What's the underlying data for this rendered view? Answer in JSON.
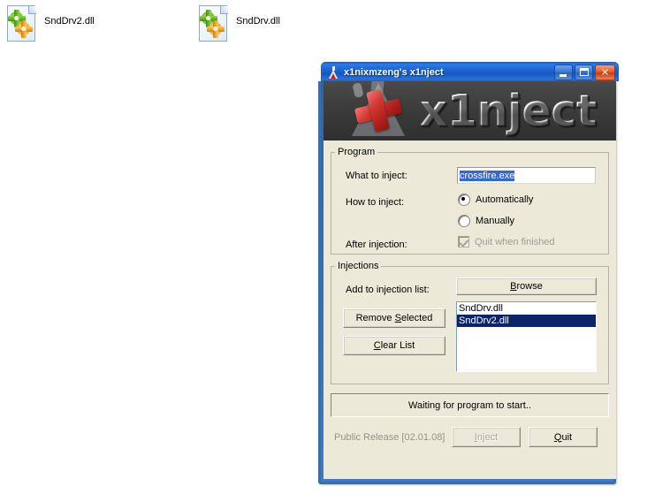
{
  "desktop": {
    "background_color": "#ffffff",
    "icons": [
      {
        "label": "SndDrv2.dll",
        "icon": "dll-file-gears-icon"
      },
      {
        "label": "SndDrv.dll",
        "icon": "dll-file-gears-icon"
      }
    ]
  },
  "window": {
    "title": "x1nixmzeng's x1nject",
    "title_icon": "flask-icon",
    "titlebar_color": "#1d63d0",
    "controls": {
      "minimize": "minimize-icon",
      "maximize": "maximize-icon",
      "close": "close-icon"
    },
    "banner": {
      "logo_text": "x1nject",
      "logo_icon": "red-cross-flask-icon",
      "background_color": "#3c3c3c"
    },
    "program_group": {
      "legend": "Program",
      "what_to_inject_label": "What to inject:",
      "what_to_inject_value": "crossfire.exe",
      "what_to_inject_placeholder": "",
      "how_to_inject_label": "How to inject:",
      "radio_automatically": "Automatically",
      "radio_manually": "Manually",
      "selected_mode": "Automatically",
      "after_injection_label": "After injection:",
      "quit_when_finished": "Quit when finished",
      "quit_when_finished_checked": true,
      "quit_when_finished_enabled": false
    },
    "injections_group": {
      "legend": "Injections",
      "add_label": "Add to injection list:",
      "browse_button": "Browse",
      "browse_accel": "B",
      "remove_selected_button": "Remove Selected",
      "remove_selected_accel": "S",
      "clear_list_button": "Clear List",
      "clear_list_accel": "C",
      "list_items": [
        {
          "label": "SndDrv.dll",
          "selected": false
        },
        {
          "label": "SndDrv2.dll",
          "selected": true
        }
      ],
      "selection_color": "#0a246a"
    },
    "status_text": "Waiting for program to start..",
    "version_text": "Public Release [02.01.08]",
    "inject_button": "Inject",
    "inject_accel": "I",
    "inject_enabled": false,
    "quit_button": "Quit",
    "quit_accel": "Q",
    "quit_enabled": true
  }
}
